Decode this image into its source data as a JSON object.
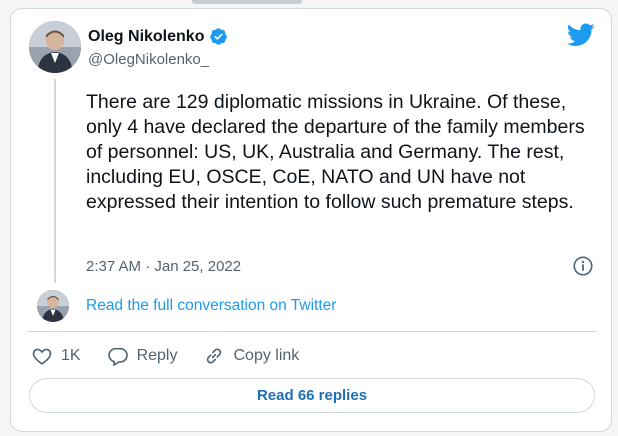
{
  "tweet": {
    "display_name": "Oleg Nikolenko",
    "handle": "@OlegNikolenko_",
    "text": "There are 129 diplomatic missions in Ukraine. Of these, only 4 have declared the departure of the family members of personnel: US, UK, Australia and Germany. The rest, including EU, OSCE, CoE, NATO and UN have not expressed their intention to follow such premature steps.",
    "timestamp": "2:37 AM · Jan 25, 2022",
    "read_conversation": "Read the full conversation on Twitter"
  },
  "actions": {
    "like_count": "1K",
    "reply_label": "Reply",
    "copy_link_label": "Copy link"
  },
  "footer": {
    "read_replies_label": "Read 66 replies"
  },
  "icons": {
    "brand": "twitter-bird-icon",
    "verified": "verified-badge-icon",
    "info": "info-icon",
    "like": "heart-icon",
    "reply": "speech-bubble-icon",
    "copy_link": "link-icon"
  },
  "colors": {
    "accent": "#1d9bf0",
    "text": "#0f1419",
    "muted": "#536471",
    "border": "#cfd9de"
  }
}
